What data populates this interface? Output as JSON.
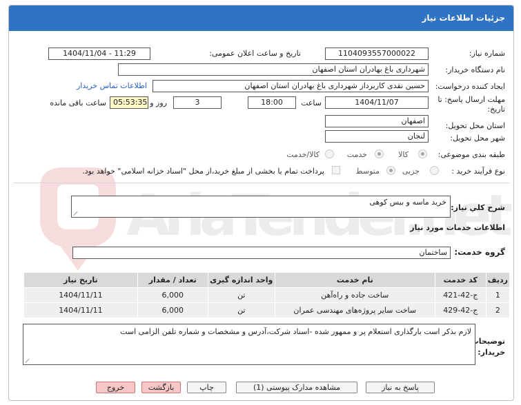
{
  "window": {
    "title": "جزئیات اطلاعات نیاز"
  },
  "form": {
    "need_number_label": "شماره نیاز:",
    "need_number": "1104093557000022",
    "announce_label": "تاریخ و ساعت اعلان عمومی:",
    "announce_value": "1404/11/04 - 11:29",
    "buyer_org_label": "نام دستگاه خریدار:",
    "buyer_org": "شهرداری باغ بهادران استان اصفهان",
    "requester_label": "ایجاد کننده درخواست:",
    "requester": "حسین نقدی کاربرداز شهرداری باغ بهادران استان اصفهان",
    "contact_link": "اطلاعات تماس خریدار",
    "deadline_label": "مهلت ارسال پاسخ: تا تاریخ:",
    "deadline_date": "1404/11/07",
    "time_label": "ساعت",
    "deadline_time": "18:00",
    "days_value": "3",
    "days_label": "روز و",
    "remaining_time": "05:53:35",
    "remaining_label": "ساعت باقی مانده",
    "province_label": "استان محل تحویل:",
    "province": "اصفهان",
    "city_label": "شهر محل تحویل:",
    "city": "لنجان",
    "category_label": "طبقه بندی موضوعی:",
    "category_options": [
      "کالا",
      "خدمت",
      "کالا/خدمت"
    ],
    "process_label": "نوع فرآیند خرید :",
    "process_options": [
      "جزیی",
      "متوسط"
    ],
    "payment_note": "پرداخت تمام یا بخشی از مبلغ خرید،از محل \"اسناد خزانه اسلامی\" خواهد بود."
  },
  "summary": {
    "label": "شرح کلي نياز:",
    "value": "خرید ماسه و بیس کوهی"
  },
  "services": {
    "section_title": "اطلاعات خدمات مورد نیاز",
    "group_label": "گروه خدمت:",
    "group_value": "ساختمان",
    "table": {
      "headers": [
        "ردیف",
        "کد خدمت",
        "نام خدمت",
        "واحد اندازه گیری",
        "تعداد / مقدار",
        "تاریخ نیاز"
      ],
      "rows": [
        [
          "1",
          "ج-42-421",
          "ساخت جاده و راه‌آهن",
          "تن",
          "6,000",
          "1404/11/11"
        ],
        [
          "2",
          "ج-42-429",
          "ساخت سایر پروژه‌های مهندسی عمران",
          "تن",
          "6,000",
          "1404/11/11"
        ]
      ]
    }
  },
  "buyer_notes": {
    "label": "توضیحات خریدار:",
    "value": "لازم بذکر است بارگذاری استعلام پر و ممهور شده -اسناد شرکت،آدرس و مشخصات و شماره تلفن الزامی است"
  },
  "buttons": {
    "reply": "پاسخ به نیاز",
    "attachments": "مشاهده مدارک پیوستی (1)",
    "print": "چاپ",
    "back": "بازگشت",
    "exit": "خروج"
  },
  "watermark_text": "AriaTender.net",
  "colors": {
    "titlebar": "#2f73c3",
    "yellow_field": "#fff9c8",
    "link": "#2a62c7",
    "danger_button": "#f7c7c7"
  }
}
